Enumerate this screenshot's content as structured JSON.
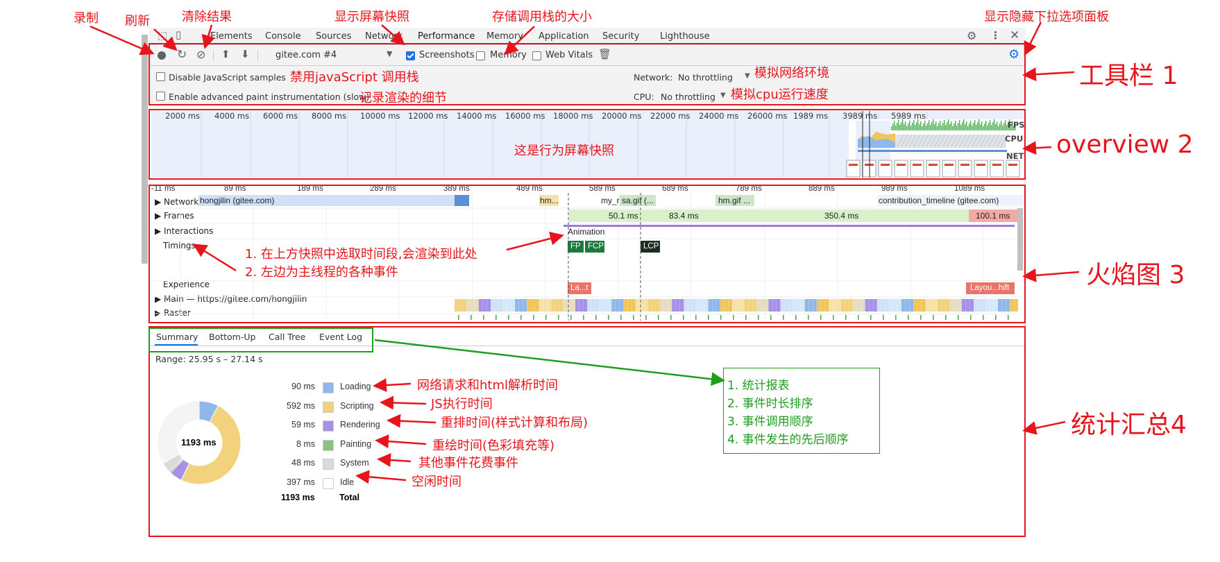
{
  "tabs": [
    "Elements",
    "Console",
    "Sources",
    "Network",
    "Performance",
    "Memory",
    "Application",
    "Security",
    "Lighthouse"
  ],
  "active_tab": "Performance",
  "toolbar": {
    "profile_select": "gitee.com #4",
    "screenshots_label": "Screenshots",
    "memory_label": "Memory",
    "webvitals_label": "Web Vitals"
  },
  "settings": {
    "disable_js_samples": "Disable JavaScript samples",
    "advanced_paint": "Enable advanced paint instrumentation (slow)",
    "network_label": "Network:",
    "network_value": "No throttling",
    "cpu_label": "CPU:",
    "cpu_value": "No throttling"
  },
  "overview": {
    "ticks": [
      "2000 ms",
      "4000 ms",
      "6000 ms",
      "8000 ms",
      "10000 ms",
      "12000 ms",
      "14000 ms",
      "16000 ms",
      "18000 ms",
      "20000 ms",
      "22000 ms",
      "24000 ms",
      "26000 ms",
      "1989 ms",
      "3989 ms",
      "5989 ms"
    ],
    "fps_label": "FPS",
    "cpu_label": "CPU",
    "net_label": "NET"
  },
  "flame": {
    "ticks": [
      "-11 ms",
      "89 ms",
      "189 ms",
      "289 ms",
      "389 ms",
      "489 ms",
      "589 ms",
      "689 ms",
      "789 ms",
      "889 ms",
      "989 ms",
      "1089 ms"
    ],
    "rows": {
      "network": "Network",
      "frames": "Frames",
      "interactions": "Interactions",
      "timings": "Timings",
      "experience": "Experience",
      "main": "Main — https://gitee.com/hongjilin",
      "raster": "Raster"
    },
    "network_items": [
      "hongjilin (gitee.com)",
      "hm...",
      "my_r",
      "sa.gif (...",
      "hm.gif ...",
      "contribution_timeline (gitee.com)"
    ],
    "frames": [
      "50.1 ms",
      "83.4 ms",
      "350.4 ms",
      "100.1 ms"
    ],
    "animation": "Animation",
    "timing_marks": [
      "FP",
      "FCP",
      "LCP"
    ],
    "experience_marks": [
      "La...t",
      "Layou...hift"
    ]
  },
  "summary": {
    "tabs": [
      "Summary",
      "Bottom-Up",
      "Call Tree",
      "Event Log"
    ],
    "range": "Range: 25.95 s – 27.14 s",
    "total_center": "1193 ms",
    "items": [
      {
        "value": "90 ms",
        "label": "Loading",
        "color": "#8fb8e8",
        "ms": 90
      },
      {
        "value": "592 ms",
        "label": "Scripting",
        "color": "#f2d27c",
        "ms": 592
      },
      {
        "value": "59 ms",
        "label": "Rendering",
        "color": "#a791e6",
        "ms": 59
      },
      {
        "value": "8 ms",
        "label": "Painting",
        "color": "#8cc37f",
        "ms": 8
      },
      {
        "value": "48 ms",
        "label": "System",
        "color": "#dadada",
        "ms": 48
      },
      {
        "value": "397 ms",
        "label": "Idle",
        "color": "#ffffff",
        "ms": 397
      }
    ],
    "total_value": "1193 ms",
    "total_label": "Total"
  },
  "annotations": {
    "record": "录制",
    "refresh": "刷新",
    "clear": "清除结果",
    "screenshot": "显示屏幕快照",
    "stack": "存储调用栈的大小",
    "hidden_panel": "显示隐藏下拉选项面板",
    "toolbar": "工具栏 1",
    "disable_js": "禁用javaScript 调用栈",
    "record_paint": "记录渲染的细节",
    "net_env": "模拟网络环境",
    "cpu_speed": "模拟cpu运行速度",
    "overview": "overview 2",
    "overview_desc": "这是行为屏幕快照",
    "flame": "火焰图 3",
    "flame_note_1": "1. 在上方快照中选取时间段,会渲染到此处",
    "flame_note_2": "2. 左边为主线程的各种事件",
    "summary": "统计汇总4",
    "loading": "网络请求和html解析时间",
    "scripting": "JS执行时间",
    "rendering": "重排时间(样式计算和布局)",
    "painting": "重绘时间(色彩填充等)",
    "system": "其他事件花费事件",
    "idle": "空闲时间",
    "green_list": [
      "1. 统计报表",
      "2. 事件时长排序",
      "3. 事件调用顺序",
      "4. 事件发生的先后顺序"
    ]
  }
}
